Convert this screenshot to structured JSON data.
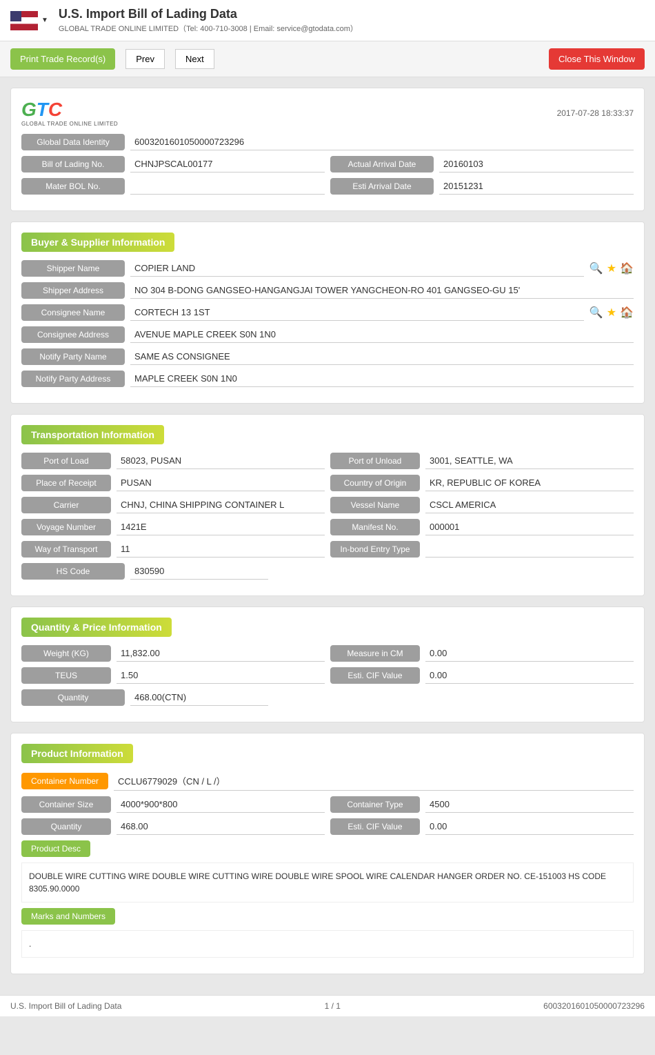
{
  "topbar": {
    "title": "U.S. Import Bill of Lading Data",
    "subtitle": "GLOBAL TRADE ONLINE LIMITED（Tel: 400-710-3008 | Email: service@gtodata.com）"
  },
  "toolbar": {
    "print_label": "Print Trade Record(s)",
    "prev_label": "Prev",
    "next_label": "Next",
    "close_label": "Close This Window"
  },
  "logo": {
    "text": "GTC",
    "sub": "GLOBAL TRADE ONLINE LIMITED",
    "timestamp": "2017-07-28 18:33:37"
  },
  "identity": {
    "global_data_identity_label": "Global Data Identity",
    "global_data_identity_value": "6003201601050000723296",
    "bill_of_lading_label": "Bill of Lading No.",
    "bill_of_lading_value": "CHNJPSCAL00177",
    "actual_arrival_label": "Actual Arrival Date",
    "actual_arrival_value": "20160103",
    "master_bol_label": "Mater BOL No.",
    "master_bol_value": "",
    "esti_arrival_label": "Esti Arrival Date",
    "esti_arrival_value": "20151231"
  },
  "buyer_supplier": {
    "section_title": "Buyer & Supplier Information",
    "shipper_name_label": "Shipper Name",
    "shipper_name_value": "COPIER LAND",
    "shipper_address_label": "Shipper Address",
    "shipper_address_value": "NO 304 B-DONG GANGSEO-HANGANGJAI TOWER YANGCHEON-RO 401 GANGSEO-GU 15'",
    "consignee_name_label": "Consignee Name",
    "consignee_name_value": "CORTECH 13 1ST",
    "consignee_address_label": "Consignee Address",
    "consignee_address_value": "AVENUE MAPLE CREEK S0N 1N0",
    "notify_party_name_label": "Notify Party Name",
    "notify_party_name_value": "SAME AS CONSIGNEE",
    "notify_party_address_label": "Notify Party Address",
    "notify_party_address_value": "MAPLE CREEK S0N 1N0"
  },
  "transportation": {
    "section_title": "Transportation Information",
    "port_of_load_label": "Port of Load",
    "port_of_load_value": "58023, PUSAN",
    "port_of_unload_label": "Port of Unload",
    "port_of_unload_value": "3001, SEATTLE, WA",
    "place_of_receipt_label": "Place of Receipt",
    "place_of_receipt_value": "PUSAN",
    "country_of_origin_label": "Country of Origin",
    "country_of_origin_value": "KR, REPUBLIC OF KOREA",
    "carrier_label": "Carrier",
    "carrier_value": "CHNJ, CHINA SHIPPING CONTAINER L",
    "vessel_name_label": "Vessel Name",
    "vessel_name_value": "CSCL AMERICA",
    "voyage_number_label": "Voyage Number",
    "voyage_number_value": "1421E",
    "manifest_no_label": "Manifest No.",
    "manifest_no_value": "000001",
    "way_of_transport_label": "Way of Transport",
    "way_of_transport_value": "11",
    "inbond_entry_label": "In-bond Entry Type",
    "inbond_entry_value": "",
    "hs_code_label": "HS Code",
    "hs_code_value": "830590"
  },
  "quantity_price": {
    "section_title": "Quantity & Price Information",
    "weight_kg_label": "Weight (KG)",
    "weight_kg_value": "11,832.00",
    "measure_cm_label": "Measure in CM",
    "measure_cm_value": "0.00",
    "teus_label": "TEUS",
    "teus_value": "1.50",
    "esti_cif_label": "Esti. CIF Value",
    "esti_cif_value": "0.00",
    "quantity_label": "Quantity",
    "quantity_value": "468.00(CTN)"
  },
  "product": {
    "section_title": "Product Information",
    "container_number_label": "Container Number",
    "container_number_value": "CCLU6779029（CN / L /）",
    "container_size_label": "Container Size",
    "container_size_value": "4000*900*800",
    "container_type_label": "Container Type",
    "container_type_value": "4500",
    "quantity_label": "Quantity",
    "quantity_value": "468.00",
    "esti_cif_label": "Esti. CIF Value",
    "esti_cif_value": "0.00",
    "product_desc_label": "Product Desc",
    "product_desc_value": "DOUBLE WIRE CUTTING WIRE DOUBLE WIRE CUTTING WIRE DOUBLE WIRE SPOOL WIRE CALENDAR HANGER ORDER NO. CE-151003 HS CODE 8305.90.0000",
    "marks_numbers_label": "Marks and Numbers",
    "marks_numbers_value": "."
  },
  "footer": {
    "left_text": "U.S. Import Bill of Lading Data",
    "page_info": "1 / 1",
    "right_text": "6003201601050000723296"
  }
}
